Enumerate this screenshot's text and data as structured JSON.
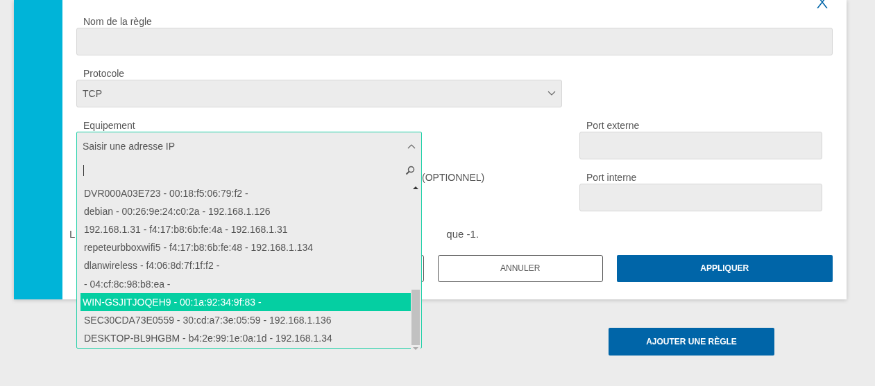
{
  "form": {
    "rule_name": {
      "label": "Nom de la règle"
    },
    "protocol": {
      "label": "Protocole",
      "value": "TCP"
    },
    "device": {
      "label": "Equipement",
      "placeholder": "Saisir une adresse IP",
      "expanded": true,
      "options": [
        {
          "label": "DVR000A03E723 - 00:18:f5:06:79:f2 -",
          "selected": false
        },
        {
          "label": "debian - 00:26:9e:24:c0:2a - 192.168.1.126",
          "selected": false
        },
        {
          "label": "192.168.1.31 - f4:17:b8:6b:fe:4a - 192.168.1.31",
          "selected": false
        },
        {
          "label": "repeteurbboxwifi5 - f4:17:b8:6b:fe:48 - 192.168.1.134",
          "selected": false
        },
        {
          "label": "dlanwireless - f4:06:8d:7f:1f:f2 -",
          "selected": false
        },
        {
          "label": "- 04:cf:8c:98:b8:ea -",
          "selected": false
        },
        {
          "label": "WIN-GSJITJOQEH9 - 00:1a:92:34:9f:83 -",
          "selected": true
        },
        {
          "label": "SEC30CDA73E0559 - 30:cd:a7:3e:05:59 - 192.168.1.136",
          "selected": false
        },
        {
          "label": "DESKTOP-BL9HGBM - b4:2e:99:1e:0a:1d - 192.168.1.34",
          "selected": false
        }
      ]
    },
    "optional_label": "(OPTIONNEL)",
    "external_port": {
      "label": "Port externe"
    },
    "internal_port": {
      "label": "Port interne"
    },
    "note_start": "L",
    "note_end": "que -1.",
    "buttons": [
      {
        "label": "ANNULER",
        "kind": "secondary"
      },
      {
        "label": "APPLIQUER",
        "kind": "primary"
      }
    ]
  },
  "add_rule_button": "AJOUTER UNE RÈGLE"
}
